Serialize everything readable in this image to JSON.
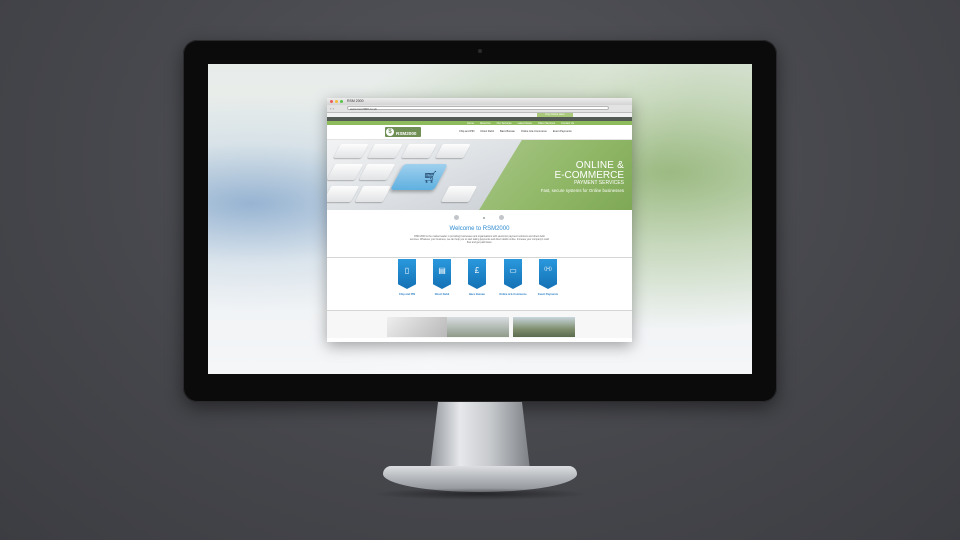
{
  "browser": {
    "tab_title": "RSM 2000",
    "url": "www.rsm2000.co.uk"
  },
  "site": {
    "top_button": "Pay Online Here",
    "green_nav": [
      "Home",
      "About Us",
      "Our Services",
      "Latest News",
      "Client Services",
      "Contact Us"
    ],
    "logo_text": "RSM2000",
    "logo_sub": "payment services",
    "main_nav": [
      "Chip and PIN",
      "Direct Debit",
      "Bacs Bureau",
      "Online & E-Commerce",
      "Event Payments"
    ],
    "hero": {
      "line1": "ONLINE &",
      "line2": "E-COMMERCE",
      "line3": "PAYMENT SERVICES",
      "line4": "Fast, secure systems for Online businesses"
    },
    "welcome": {
      "title": "Welcome to RSM2000",
      "text": "RSM 2000 is the market leader in providing businesses and organisations with electronic payment solutions and direct debit services. Whatever your business, we can help you to start taking payments and direct debits online. Increase your company's cash flow and get paid faster."
    },
    "services": [
      {
        "label": "Chip and PIN",
        "icon": "card-terminal-icon",
        "glyph": "▯"
      },
      {
        "label": "Direct Debit",
        "icon": "direct-debit-icon",
        "glyph": "▤"
      },
      {
        "label": "Bacs Bureau",
        "icon": "pound-icon",
        "glyph": "£"
      },
      {
        "label": "Online & E-Commerce",
        "icon": "monitor-icon",
        "glyph": "▭"
      },
      {
        "label": "Event Payments",
        "icon": "wifi-icon",
        "glyph": "((•))"
      }
    ]
  },
  "colors": {
    "accent_green": "#8ebb5b",
    "accent_blue": "#2a98dd"
  }
}
